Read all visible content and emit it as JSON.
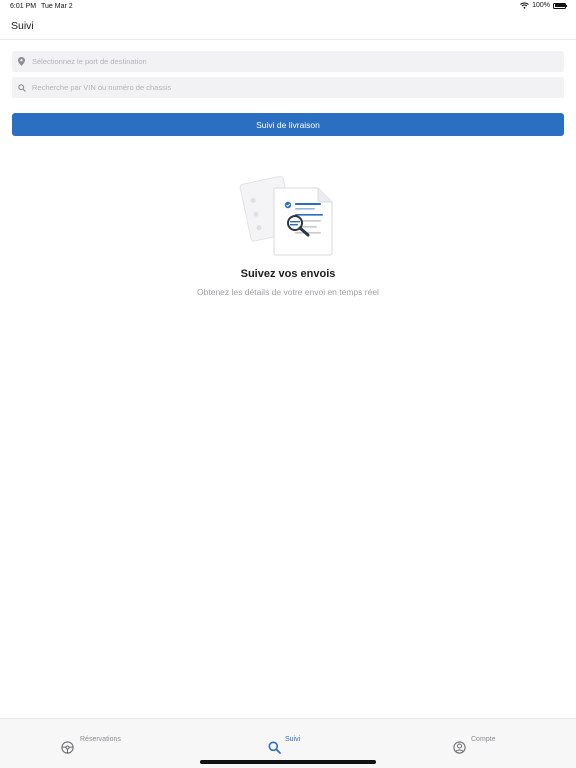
{
  "status_bar": {
    "time": "6:01 PM",
    "date": "Tue Mar 2",
    "battery": "100%"
  },
  "nav": {
    "title": "Suivi"
  },
  "search": {
    "port_placeholder": "Sélectionnez le port de destination",
    "vin_placeholder": "Recherche par VIN ou numéro de chassis"
  },
  "actions": {
    "track_label": "Suivi de livraison"
  },
  "empty_state": {
    "title": "Suivez vos envois",
    "subtitle": "Obtenez les détails de votre envoi en temps réel"
  },
  "tabs": [
    {
      "label": "Réservations",
      "icon": "steering-wheel-icon"
    },
    {
      "label": "Suivi",
      "icon": "search-icon",
      "active": true
    },
    {
      "label": "Compte",
      "icon": "account-icon"
    }
  ],
  "colors": {
    "accent": "#2a6fc1",
    "field_bg": "#f2f2f4",
    "muted_text": "#a0a0a6"
  }
}
